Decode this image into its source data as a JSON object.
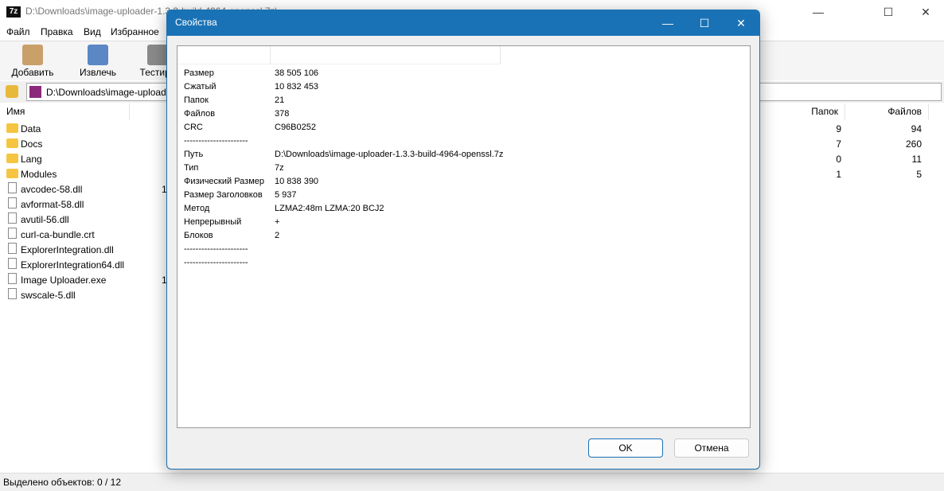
{
  "window": {
    "title": "D:\\Downloads\\image-uploader-1.3.3-build-4964-openssl.7z\\",
    "app_icon": "7z"
  },
  "menu": [
    "Файл",
    "Правка",
    "Вид",
    "Избранное"
  ],
  "toolbar": [
    {
      "label": "Добавить",
      "icon": "add-icon"
    },
    {
      "label": "Извлечь",
      "icon": "extract-icon"
    },
    {
      "label": "Тестиро",
      "icon": "test-icon"
    }
  ],
  "address": "D:\\Downloads\\image-uploader-1.3.3-build-4964-openssl.7z\\",
  "list": {
    "columns": [
      "Имя",
      "Папок",
      "Файлов"
    ],
    "rows": [
      {
        "name": "Data",
        "type": "folder",
        "size": "",
        "folders": "9",
        "files": "94"
      },
      {
        "name": "Docs",
        "type": "folder",
        "size": "",
        "folders": "7",
        "files": "260"
      },
      {
        "name": "Lang",
        "type": "folder",
        "size": "",
        "folders": "0",
        "files": "11"
      },
      {
        "name": "Modules",
        "type": "folder",
        "size": "",
        "folders": "1",
        "files": "5"
      },
      {
        "name": "avcodec-58.dll",
        "type": "file",
        "size": "1",
        "folders": "",
        "files": ""
      },
      {
        "name": "avformat-58.dll",
        "type": "file",
        "size": "",
        "folders": "",
        "files": ""
      },
      {
        "name": "avutil-56.dll",
        "type": "file",
        "size": "",
        "folders": "",
        "files": ""
      },
      {
        "name": "curl-ca-bundle.crt",
        "type": "file",
        "size": "",
        "folders": "",
        "files": ""
      },
      {
        "name": "ExplorerIntegration.dll",
        "type": "file",
        "size": "",
        "folders": "",
        "files": ""
      },
      {
        "name": "ExplorerIntegration64.dll",
        "type": "file",
        "size": "",
        "folders": "",
        "files": ""
      },
      {
        "name": "Image Uploader.exe",
        "type": "exe",
        "size": "1",
        "folders": "",
        "files": ""
      },
      {
        "name": "swscale-5.dll",
        "type": "file",
        "size": "",
        "folders": "",
        "files": ""
      }
    ]
  },
  "status": "Выделено объектов: 0 / 12",
  "dialog": {
    "title": "Свойства",
    "props": [
      {
        "k": "Размер",
        "v": "38 505 106"
      },
      {
        "k": "Сжатый",
        "v": "10 832 453"
      },
      {
        "k": "Папок",
        "v": "21"
      },
      {
        "k": "Файлов",
        "v": "378"
      },
      {
        "k": "CRC",
        "v": "C96B0252"
      },
      {
        "k": "----------------------",
        "v": ""
      },
      {
        "k": "Путь",
        "v": "D:\\Downloads\\image-uploader-1.3.3-build-4964-openssl.7z"
      },
      {
        "k": "Тип",
        "v": "7z"
      },
      {
        "k": "Физический Размер",
        "v": "10 838 390"
      },
      {
        "k": "Размер Заголовков",
        "v": "5 937"
      },
      {
        "k": "Метод",
        "v": "LZMA2:48m LZMA:20 BCJ2"
      },
      {
        "k": "Непрерывный",
        "v": "+"
      },
      {
        "k": "Блоков",
        "v": "2"
      },
      {
        "k": "----------------------",
        "v": ""
      },
      {
        "k": "----------------------",
        "v": ""
      }
    ],
    "ok": "OK",
    "cancel": "Отмена"
  },
  "colors": {
    "accent": "#1a72b6"
  }
}
